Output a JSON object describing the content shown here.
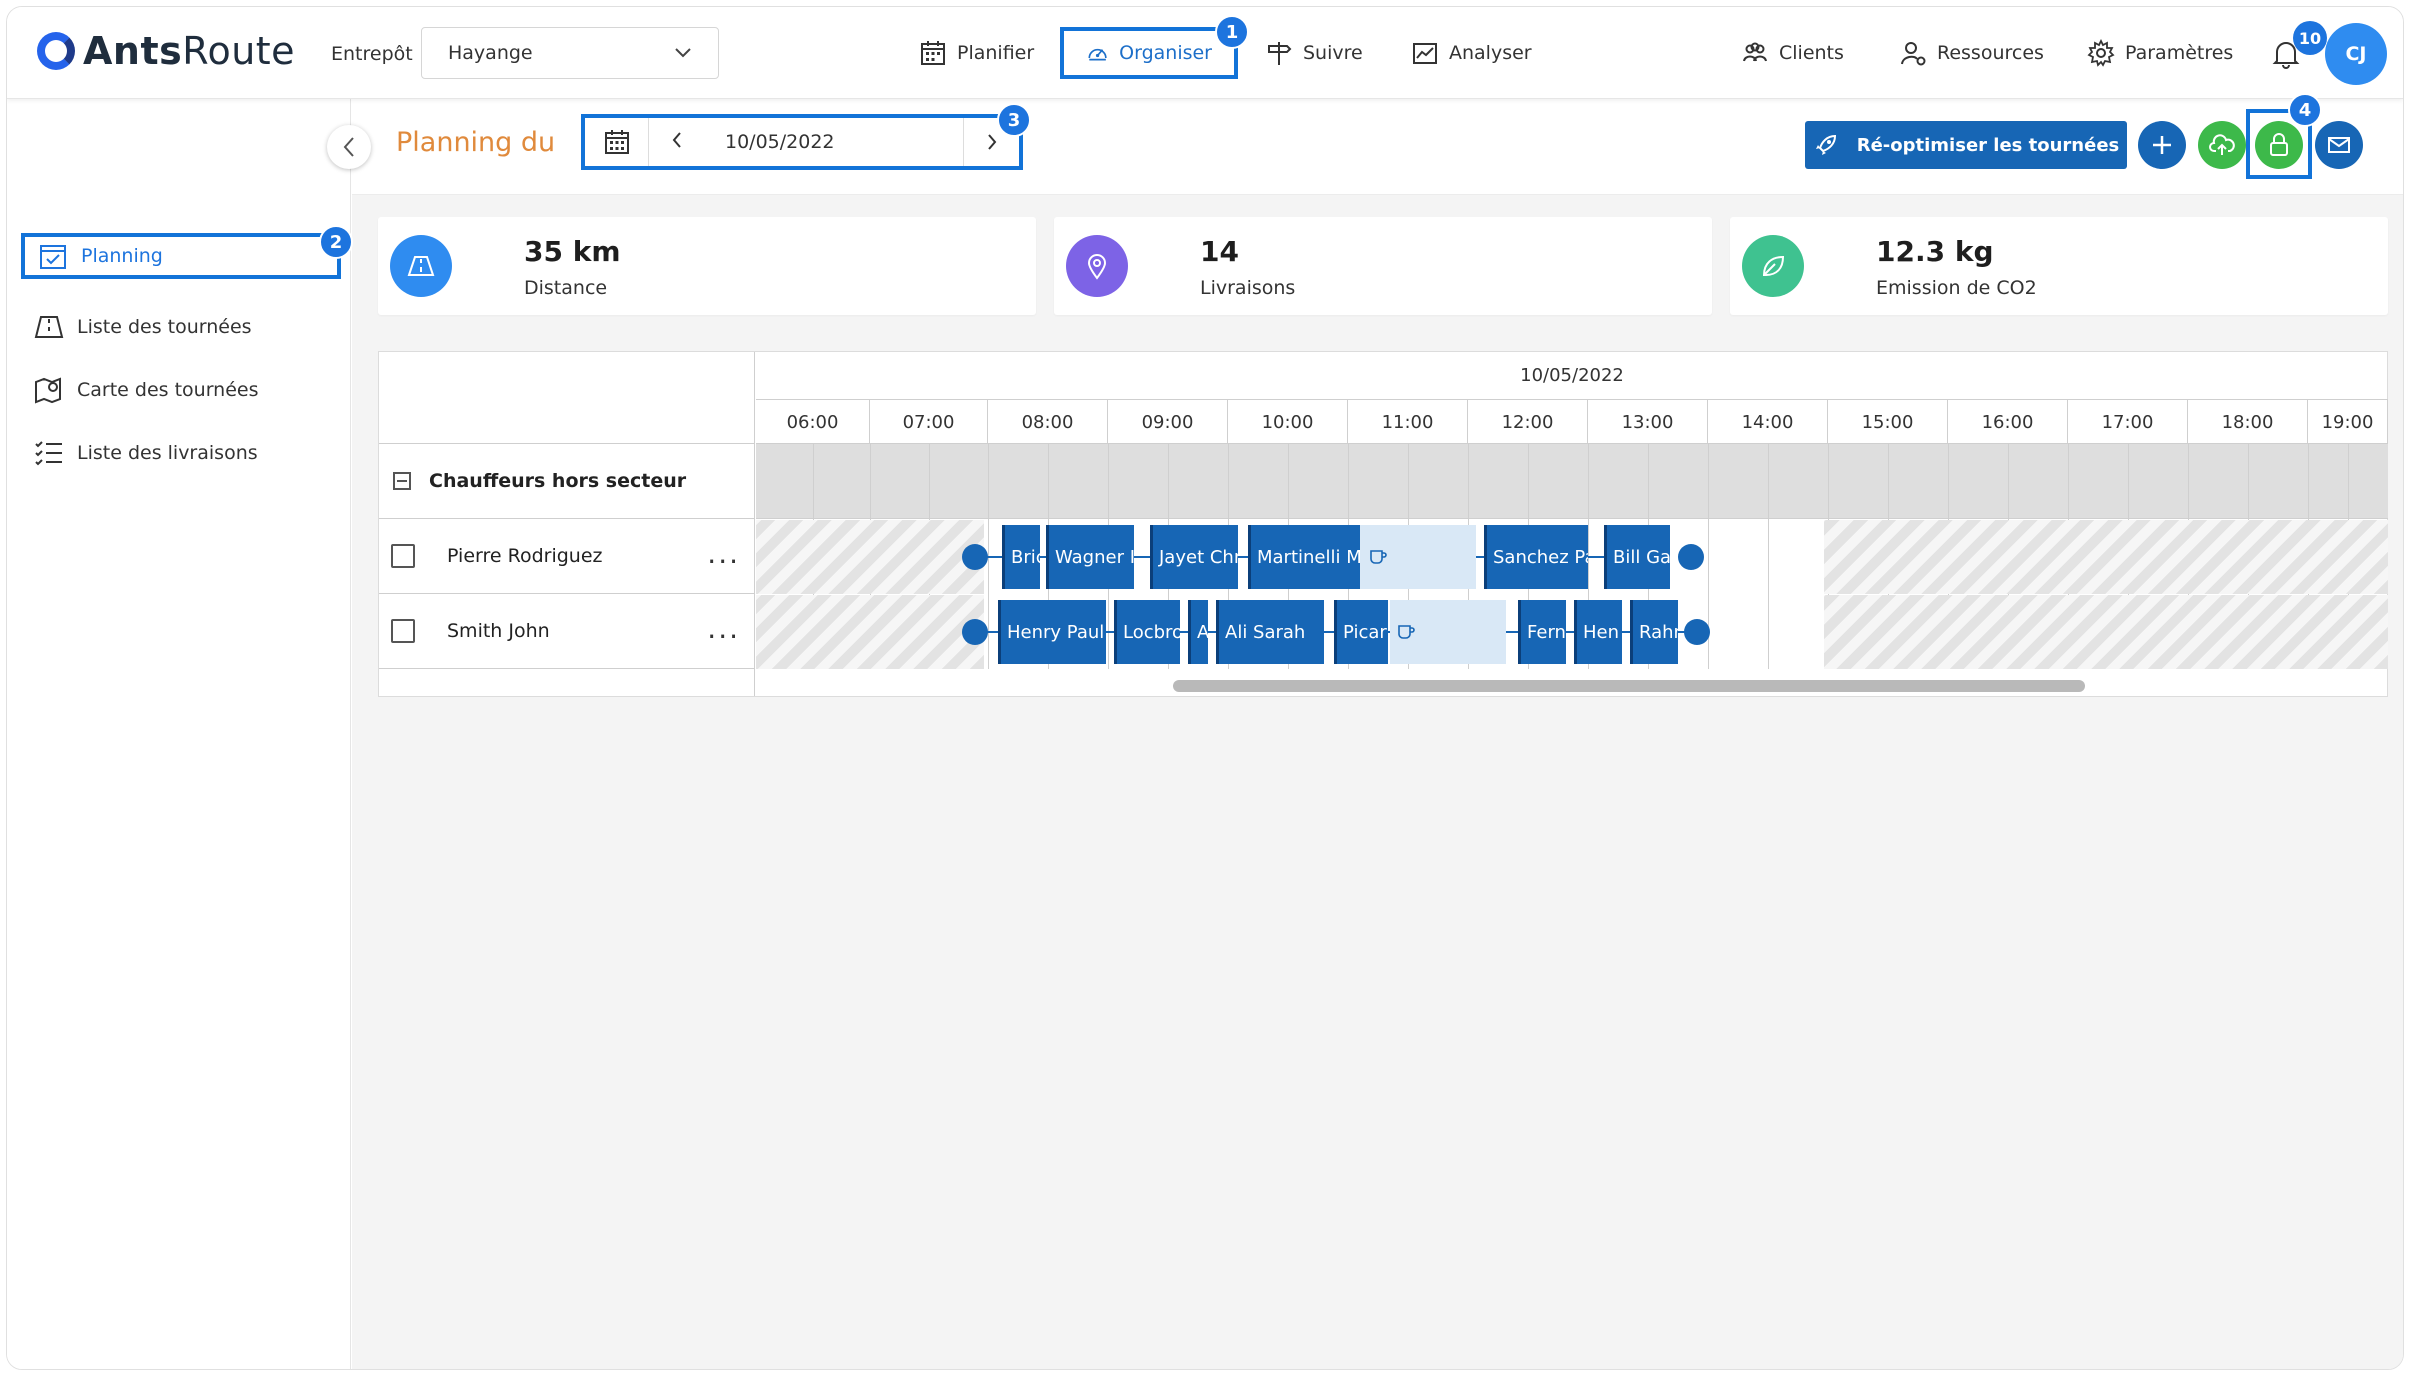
{
  "app": {
    "logo_part1": "Ants",
    "logo_part2": "Route"
  },
  "header": {
    "warehouse_label": "Entrepôt",
    "warehouse_value": "Hayange",
    "nav": [
      {
        "label": "Planifier",
        "icon": "calendar-icon"
      },
      {
        "label": "Organiser",
        "icon": "gauge-icon",
        "active": true,
        "marker": "1"
      },
      {
        "label": "Suivre",
        "icon": "signpost-icon"
      },
      {
        "label": "Analyser",
        "icon": "chart-icon"
      },
      {
        "label": "Clients",
        "icon": "clients-icon"
      },
      {
        "label": "Ressources",
        "icon": "resources-icon"
      },
      {
        "label": "Paramètres",
        "icon": "gear-icon"
      }
    ],
    "notifications": "10",
    "avatar": "CJ"
  },
  "sidebar": {
    "items": [
      {
        "label": "Planning",
        "icon": "calendar-check-icon",
        "active": true,
        "marker": "2"
      },
      {
        "label": "Liste des tournées",
        "icon": "map-book-icon"
      },
      {
        "label": "Carte des tournées",
        "icon": "map-pin-icon"
      },
      {
        "label": "Liste des livraisons",
        "icon": "checklist-icon"
      }
    ]
  },
  "toolbar": {
    "title": "Planning du",
    "date": "10/05/2022",
    "date_marker": "3",
    "reoptimize_label": "Ré-optimiser les tournées",
    "lock_marker": "4",
    "colors": {
      "primary": "#1766b5",
      "green": "#3db94a",
      "marker": "#1d74de"
    }
  },
  "kpis": [
    {
      "value": "35 km",
      "label": "Distance",
      "icon": "road-icon",
      "color": "#2f8cf0"
    },
    {
      "value": "14",
      "label": "Livraisons",
      "icon": "location-icon",
      "color": "#7d63e6"
    },
    {
      "value": "12.3 kg",
      "label": "Emission de CO2",
      "icon": "leaf-icon",
      "color": "#3fc290"
    }
  ],
  "gantt": {
    "date": "10/05/2022",
    "hours": [
      "06:00",
      "07:00",
      "08:00",
      "09:00",
      "10:00",
      "11:00",
      "12:00",
      "13:00",
      "14:00",
      "15:00",
      "16:00",
      "17:00",
      "18:00",
      "19:00"
    ],
    "group_label": "Chauffeurs hors secteur",
    "drivers": [
      {
        "name": "Pierre Rodriguez",
        "menu": "...",
        "deliveries": [
          "Bric",
          "Wagner I",
          "Jayet Chr",
          "Martinelli M",
          "Sanchez Pa",
          "Bill Ga"
        ]
      },
      {
        "name": "Smith John",
        "menu": "...",
        "deliveries": [
          "Henry Paul",
          "Locbro",
          "A",
          "Ali Sarah",
          "Picar",
          "Fern",
          "Hen",
          "Rahr"
        ]
      }
    ]
  }
}
